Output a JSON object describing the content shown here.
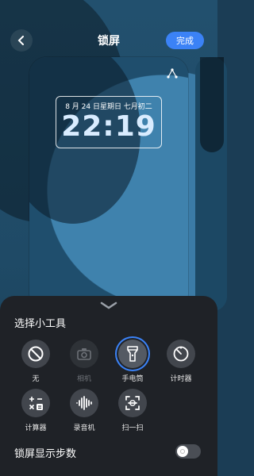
{
  "header": {
    "title": "锁屏",
    "done_label": "完成"
  },
  "lockscreen": {
    "date": "8 月 24 日星期日 七月初二",
    "time": "22:19"
  },
  "sheet": {
    "title": "选择小工具",
    "tools": [
      {
        "label": "无",
        "icon": "prohibited-icon",
        "state": "normal"
      },
      {
        "label": "相机",
        "icon": "camera-icon",
        "state": "disabled"
      },
      {
        "label": "手电筒",
        "icon": "flashlight-icon",
        "state": "selected"
      },
      {
        "label": "计时器",
        "icon": "timer-icon",
        "state": "normal"
      },
      {
        "label": "计算器",
        "icon": "calculator-icon",
        "state": "normal"
      },
      {
        "label": "录音机",
        "icon": "voice-recorder-icon",
        "state": "normal"
      },
      {
        "label": "扫一扫",
        "icon": "scan-icon",
        "state": "normal"
      }
    ],
    "steps_toggle": {
      "label": "锁屏显示步数",
      "on": false
    }
  },
  "colors": {
    "accent": "#3b82f6",
    "sheet_bg": "#1f2227"
  }
}
